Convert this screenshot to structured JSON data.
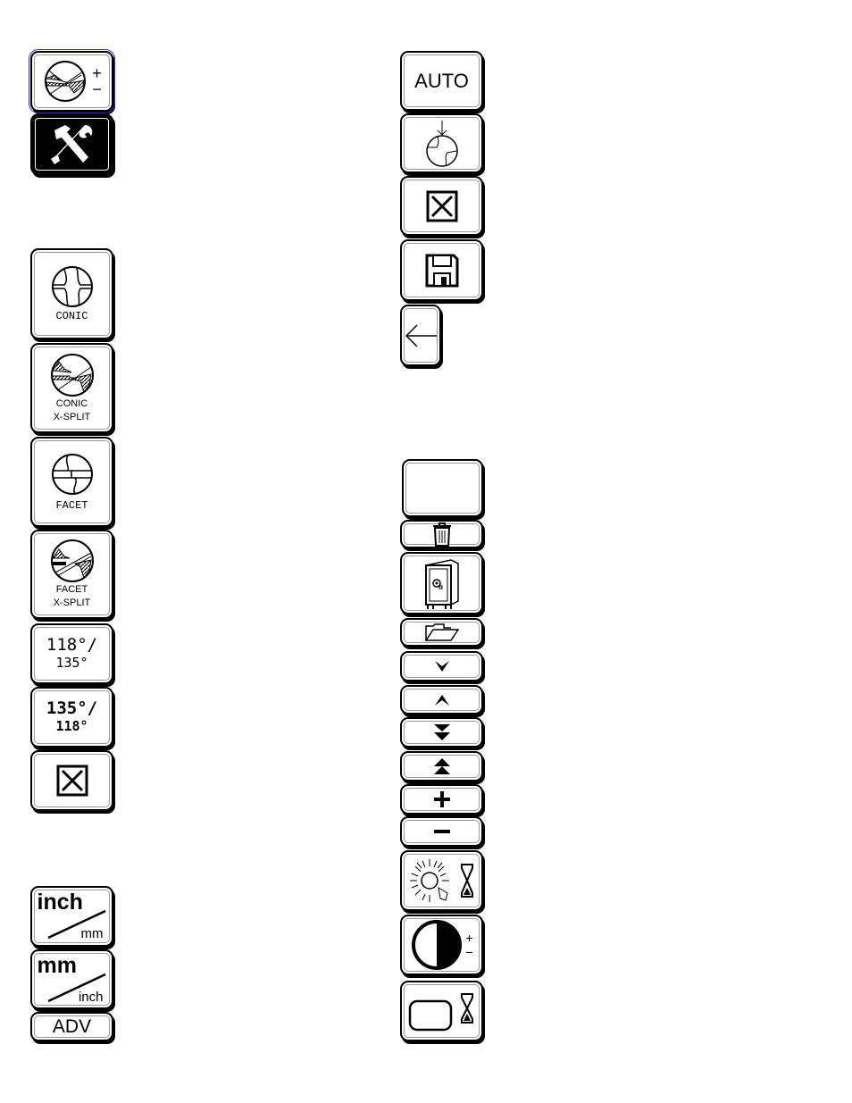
{
  "left_column": {
    "lens_adjust": {
      "plus": "+",
      "minus": "−"
    },
    "conic": {
      "label": "CONIC"
    },
    "conic_xsplit": {
      "line1": "CONIC",
      "line2": "X-SPLIT"
    },
    "facet": {
      "label": "FACET"
    },
    "facet_xsplit": {
      "line1": "FACET",
      "line2": "X-SPLIT"
    },
    "angle_118_135": {
      "top": "118°/",
      "bottom": "135°"
    },
    "angle_135_118": {
      "top": "135°/",
      "bottom": "118°"
    },
    "inch_mm": {
      "top": "inch",
      "bottom": "mm"
    },
    "mm_inch": {
      "top": "mm",
      "bottom": "inch"
    },
    "adv": {
      "label": "ADV"
    }
  },
  "right_column": {
    "auto": {
      "label": "AUTO"
    },
    "contrast": {
      "plus": "+",
      "minus": "−"
    }
  },
  "colors": {
    "foreground": "#000000",
    "background": "#ffffff",
    "selection_outline": "#3a2fb0"
  }
}
